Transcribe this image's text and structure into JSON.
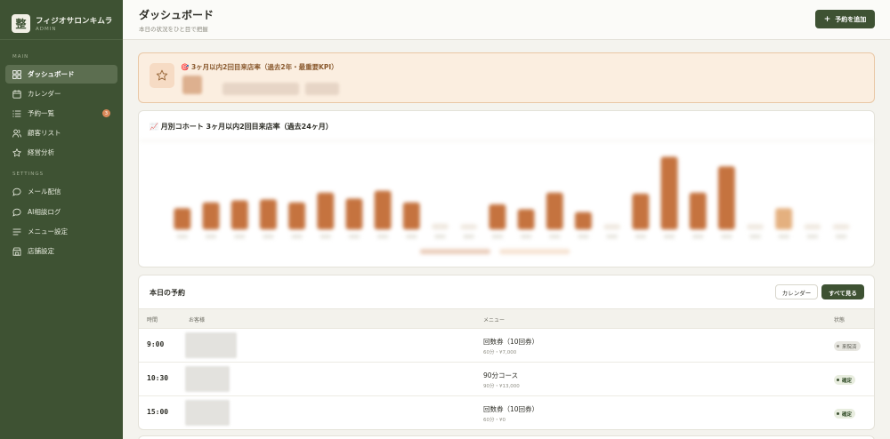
{
  "brand": {
    "logo_char": "整",
    "name": "フィジオサロンキムラ",
    "sub": "ADMIN"
  },
  "sidebar": {
    "sections": [
      {
        "label": "MAIN"
      },
      {
        "label": "SETTINGS"
      }
    ],
    "items": [
      {
        "label": "ダッシュボード",
        "icon": "dashboard-grid-icon",
        "active": true
      },
      {
        "label": "カレンダー",
        "icon": "calendar-icon"
      },
      {
        "label": "予約一覧",
        "icon": "list-icon",
        "badge": "3"
      },
      {
        "label": "顧客リスト",
        "icon": "users-icon"
      },
      {
        "label": "経営分析",
        "icon": "star-icon"
      },
      {
        "label": "メール配信",
        "icon": "chat-bubble-icon"
      },
      {
        "label": "AI相談ログ",
        "icon": "chat-bubble-icon"
      },
      {
        "label": "メニュー設定",
        "icon": "menu-lines-icon"
      },
      {
        "label": "店舗設定",
        "icon": "store-icon"
      }
    ]
  },
  "header": {
    "title": "ダッシュボード",
    "subtitle": "本日の状況をひと目で把握",
    "add_button": "予約を追加"
  },
  "kpi": {
    "icon": "star-icon",
    "title": "🎯 3ヶ月以内2回目来店率（過去2年・最重要KPI）"
  },
  "cohort": {
    "title": "📈 月別コホート 3ヶ月以内2回目来店率（過去24ヶ月）"
  },
  "chart_data": {
    "type": "bar",
    "title": "📈 月別コホート 3ヶ月以内2回目来店率（過去24ヶ月）",
    "categories": [],
    "values": [
      22,
      28,
      30,
      31,
      28,
      38,
      32,
      40,
      28,
      6,
      5,
      26,
      21,
      38,
      18,
      4,
      37,
      75,
      38,
      65,
      5,
      22,
      4,
      4
    ],
    "colors": {
      "main": "#c5733f",
      "light": "#e4b07f",
      "faint": "#efe8df"
    },
    "grid": false
  },
  "bookings": {
    "title": "本日の予約",
    "calendar_button": "カレンダー",
    "all_button": "すべて見る",
    "columns": [
      "時間",
      "お客様",
      "メニュー",
      "状態"
    ],
    "rows": [
      {
        "time": "9:00",
        "menu": "回数券（10回券）",
        "detail": "60分・¥7,000",
        "status": "来院済",
        "status_kind": "visited"
      },
      {
        "time": "10:30",
        "menu": "90分コース",
        "detail": "90分・¥13,000",
        "status": "確定",
        "status_kind": "confirmed"
      },
      {
        "time": "15:00",
        "menu": "回数券（10回券）",
        "detail": "60分・¥0",
        "status": "確定",
        "status_kind": "confirmed"
      }
    ]
  },
  "colors": {
    "sidebar": "#3e5233",
    "accent": "#3e5233",
    "kpi_bg": "#fbeee0",
    "bar": "#c5733f"
  }
}
